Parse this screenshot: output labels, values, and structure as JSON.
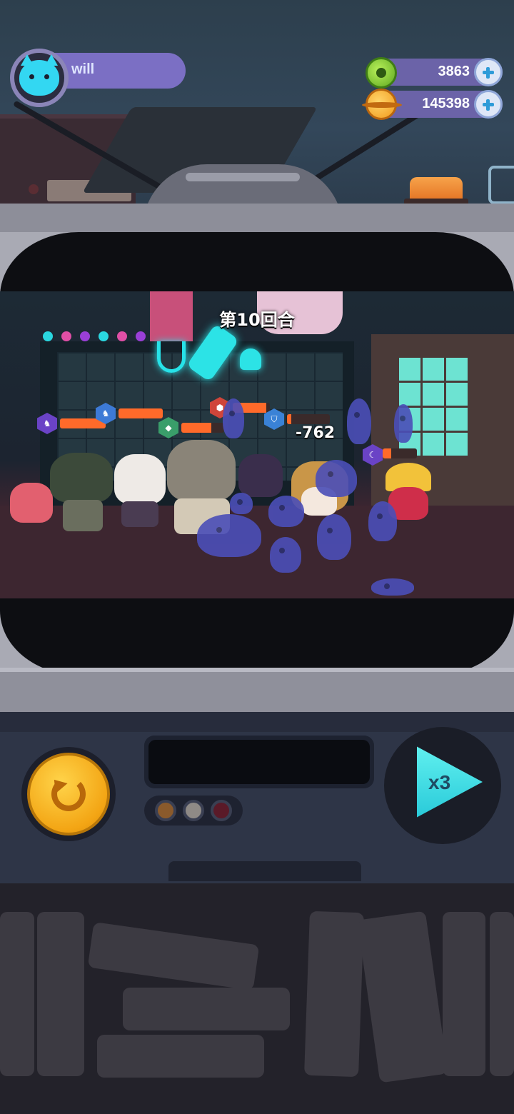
{
  "player": {
    "name": "will",
    "avatar_icon": "cat-face-icon"
  },
  "currencies": [
    {
      "name": "gems",
      "icon": "green-coin-icon",
      "amount": "3863"
    },
    {
      "name": "gold",
      "icon": "gold-planet-coin-icon",
      "amount": "145398"
    }
  ],
  "battle": {
    "round_label": "第10回合",
    "damage_popup": "-762"
  },
  "controls": {
    "retry_icon": "retry-arrow-icon",
    "speed_label": "x3"
  },
  "colors": {
    "hp_bar": "#ff6a2a",
    "neon": "#2ce3e6",
    "accent_purple": "#7b6fc4"
  }
}
